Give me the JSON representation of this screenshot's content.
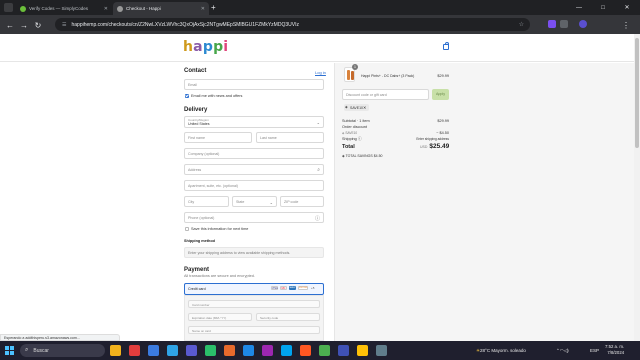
{
  "browser": {
    "tabs": [
      {
        "title": "Verify Codes — SimplyCodes",
        "active": false,
        "icon": "simplycodes-favicon"
      },
      {
        "title": "Checkout - Happi",
        "active": true,
        "icon": "happi-favicon"
      }
    ],
    "new_tab_label": "+",
    "url": "happihemp.com/checkouts/cn/Z2NwLXVzLWVhc3QxOjAxSjc2NTgwMEpSMlBGU1FZMkYzMDQ3UVIz",
    "window_controls": {
      "minimize": "—",
      "maximize": "□",
      "close": "✕"
    }
  },
  "header": {
    "logo_letters": [
      "h",
      "a",
      "p",
      "p",
      "i"
    ],
    "logo_colors": [
      "#cf9a1d",
      "#8a5ba8",
      "#2c8ad1",
      "#47a64a",
      "#e0457b"
    ],
    "cart_icon": "bag-icon"
  },
  "contact": {
    "heading": "Contact",
    "login_link": "Log in",
    "email_placeholder": "Email",
    "newsletter_label": "Email me with news and offers"
  },
  "delivery": {
    "heading": "Delivery",
    "country_label": "Country/Region",
    "country_value": "United States",
    "first_name": "First name",
    "last_name": "Last name",
    "company": "Company (optional)",
    "address": "Address",
    "apartment": "Apartment, suite, etc. (optional)",
    "city": "City",
    "state": "State",
    "zip": "ZIP code",
    "phone": "Phone (optional)",
    "save_info_label": "Save this information for next time"
  },
  "shipping": {
    "heading": "Shipping method",
    "message": "Enter your shipping address to view available shipping methods."
  },
  "payment": {
    "heading": "Payment",
    "subtext": "All transactions are secure and encrypted.",
    "method_label": "Credit card",
    "cards": [
      "VISA",
      "MC",
      "AMEX",
      "DISCOVER",
      "+5"
    ],
    "card_colors": [
      "#1a1f71",
      "#eb001b",
      "#2e77bc",
      "#f58220"
    ],
    "card_number": "Card number",
    "expiration": "Expiration date (MM / YY)",
    "security_code": "Security code",
    "name_on_card": "Name on card"
  },
  "summary": {
    "item": {
      "quantity": "1",
      "name": "Happi Pints+ - DC Dabs+ (3 Pack)",
      "price": "$29.99"
    },
    "discount_placeholder": "Discount code or gift card",
    "apply_label": "Apply",
    "applied_code": "SAVE10",
    "subtotal_label": "Subtotal · 1 item",
    "subtotal_value": "$29.99",
    "order_discount_label": "Order discount",
    "code_label": "SAVE10",
    "discount_value": "− $4.50",
    "shipping_label": "Shipping",
    "shipping_value": "Enter shipping address",
    "total_label": "Total",
    "currency": "USD",
    "total_value": "$25.49",
    "savings_label": "TOTAL SAVINGS",
    "savings_value": "$4.50"
  },
  "status_bar_text": "Esperando a addthisperu.s3.amazonaws.com...",
  "taskbar": {
    "search_placeholder": "Buscar",
    "weather": "28°C  Mayorm. soleado",
    "language": "ESP",
    "time": "7:52 a. m.",
    "date": "7/8/2024",
    "app_colors": [
      "#f2b21c",
      "#e23d3d",
      "#3b7be0",
      "#2fa4e7",
      "#5a5ad0",
      "#2bbf6a",
      "#e86a2c",
      "#1e88e5",
      "#9c27b0",
      "#00a4ef",
      "#ff5722",
      "#4caf50",
      "#3f51b5",
      "#ffc107",
      "#607d8b"
    ]
  }
}
